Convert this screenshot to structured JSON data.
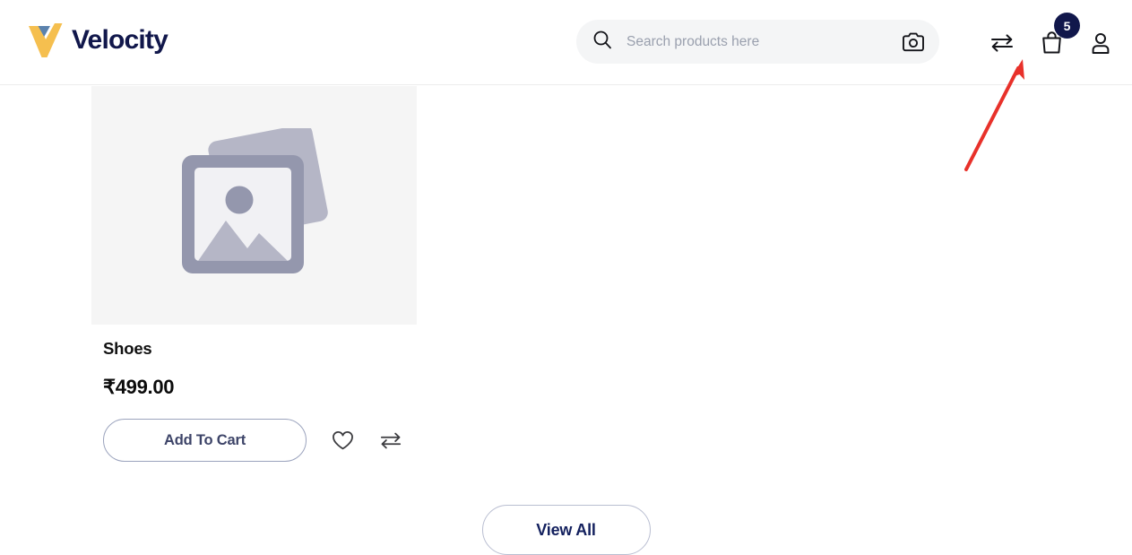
{
  "brand": {
    "name": "Velocity",
    "logo_icon": "velocity-check-logo",
    "logo_check_color": "#f5bf4f",
    "logo_triangle_color": "#5b82ad",
    "name_color": "#11174b"
  },
  "header": {
    "search": {
      "icon": "search-icon",
      "placeholder": "Search products here",
      "value": "",
      "camera_icon": "camera-icon"
    },
    "actions": {
      "compare": {
        "icon": "compare-arrows-icon",
        "label": "Compare"
      },
      "cart": {
        "icon": "shopping-bag-icon",
        "label": "Cart",
        "badge_count": "5",
        "badge_color": "#11174b"
      },
      "account": {
        "icon": "user-account-icon",
        "label": "Account"
      }
    }
  },
  "main": {
    "product": {
      "image_placeholder_icon": "image-placeholder-icon",
      "title": "Shoes",
      "price": "₹499.00",
      "add_to_cart_label": "Add To Cart",
      "wishlist_icon": "heart-icon",
      "compare_icon": "compare-arrows-icon"
    },
    "view_all_label": "View All"
  },
  "annotation": {
    "arrow_color": "#e8312a",
    "arrow_target": "shopping-bag-icon"
  }
}
